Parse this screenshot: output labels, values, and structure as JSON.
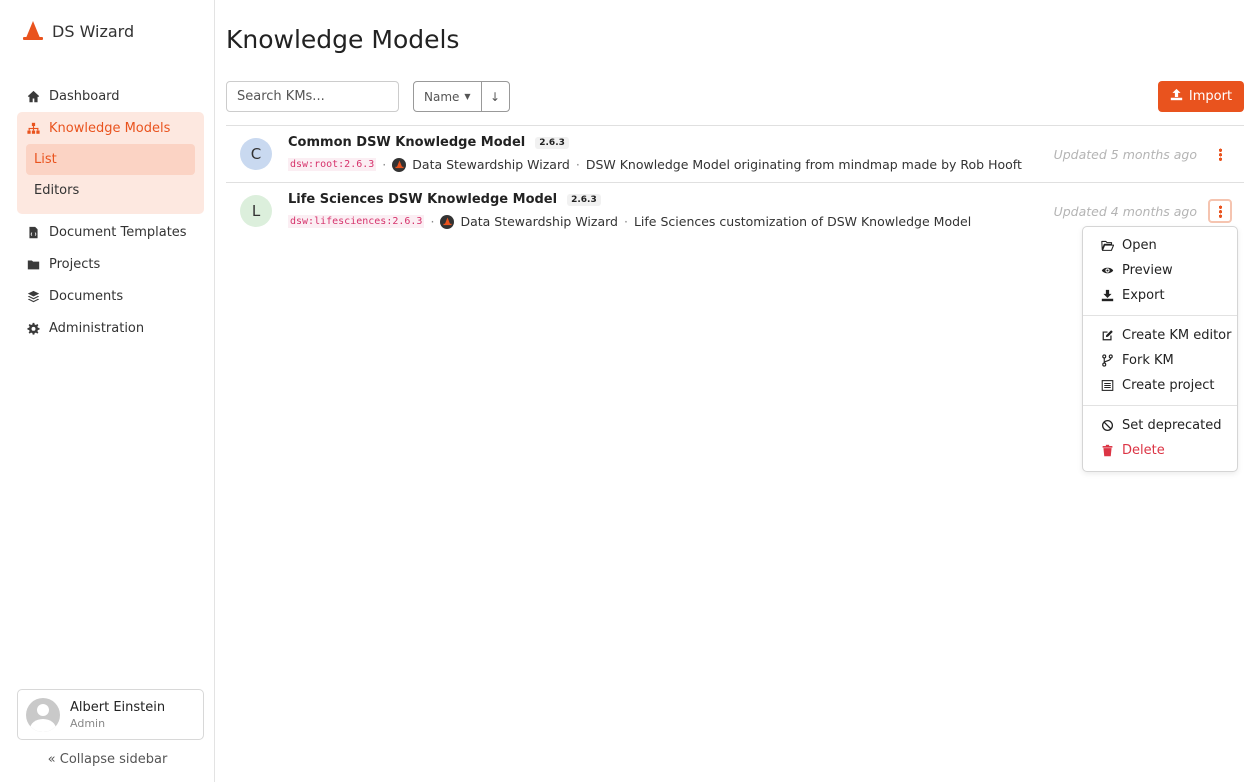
{
  "brand": {
    "name": "DS Wizard"
  },
  "sidebar": {
    "items": [
      {
        "label": "Dashboard",
        "icon": "home-icon"
      },
      {
        "label": "Knowledge Models",
        "icon": "sitemap-icon"
      },
      {
        "label": "Document Templates",
        "icon": "file-code-icon"
      },
      {
        "label": "Projects",
        "icon": "folder-icon"
      },
      {
        "label": "Documents",
        "icon": "layers-icon"
      },
      {
        "label": "Administration",
        "icon": "cog-icon"
      }
    ],
    "sub_items": [
      {
        "label": "List"
      },
      {
        "label": "Editors"
      }
    ],
    "profile": {
      "name": "Albert Einstein",
      "role": "Admin"
    },
    "collapse_label": "Collapse sidebar"
  },
  "main": {
    "title": "Knowledge Models",
    "search_placeholder": "Search KMs...",
    "sort_label": "Name",
    "import_label": "Import",
    "accent_color": "#e9531e",
    "rows": [
      {
        "initial": "C",
        "avatar_color": "#c9d9f0",
        "title": "Common DSW Knowledge Model",
        "version": "2.6.3",
        "km_id": "dsw:root:2.6.3",
        "organization": "Data Stewardship Wizard",
        "description": "DSW Knowledge Model originating from mindmap made by Rob Hooft",
        "updated": "Updated 5 months ago"
      },
      {
        "initial": "L",
        "avatar_color": "#dcefdc",
        "title": "Life Sciences DSW Knowledge Model",
        "version": "2.6.3",
        "km_id": "dsw:lifesciences:2.6.3",
        "organization": "Data Stewardship Wizard",
        "description": "Life Sciences customization of DSW Knowledge Model",
        "updated": "Updated 4 months ago"
      }
    ]
  },
  "dropdown": {
    "items": [
      {
        "label": "Open",
        "icon": "folder-open-icon"
      },
      {
        "label": "Preview",
        "icon": "eye-icon"
      },
      {
        "label": "Export",
        "icon": "download-icon"
      },
      {
        "label": "Create KM editor",
        "icon": "edit-icon"
      },
      {
        "label": "Fork KM",
        "icon": "code-branch-icon"
      },
      {
        "label": "Create project",
        "icon": "list-icon"
      },
      {
        "label": "Set deprecated",
        "icon": "ban-icon"
      },
      {
        "label": "Delete",
        "icon": "trash-icon"
      }
    ]
  }
}
